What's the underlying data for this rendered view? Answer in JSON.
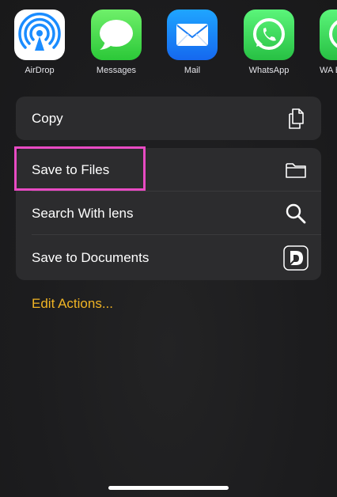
{
  "share_sheet": {
    "apps": [
      {
        "label": "AirDrop",
        "icon": "airdrop-icon"
      },
      {
        "label": "Messages",
        "icon": "messages-icon"
      },
      {
        "label": "Mail",
        "icon": "mail-icon"
      },
      {
        "label": "WhatsApp",
        "icon": "whatsapp-icon"
      },
      {
        "label": "WA B",
        "icon": "whatsapp-business-icon"
      }
    ],
    "actions": {
      "copy": {
        "label": "Copy",
        "icon": "copy-icon"
      },
      "save_to_files": {
        "label": "Save to Files",
        "icon": "folder-icon"
      },
      "search_with_lens": {
        "label": "Search With lens",
        "icon": "search-icon"
      },
      "save_to_documents": {
        "label": "Save to Documents",
        "icon": "documents-app-icon"
      }
    },
    "edit_actions_label": "Edit Actions...",
    "colors": {
      "background": "#1c1c1e",
      "group_background": "#2c2c2e",
      "accent": "#f0b424",
      "highlight": "#e84bc3"
    }
  }
}
